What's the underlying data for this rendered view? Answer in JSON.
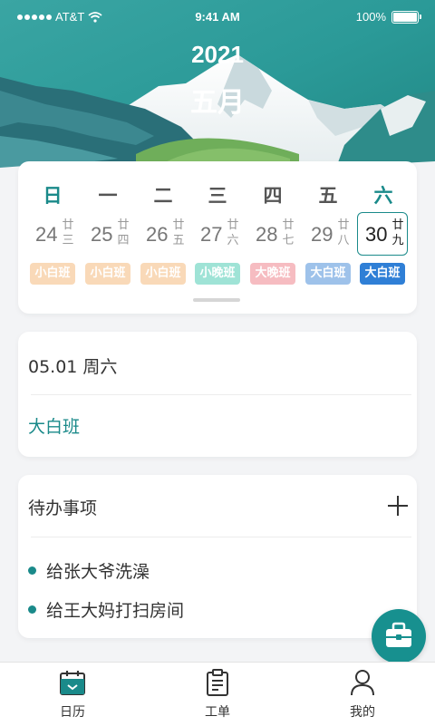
{
  "status_bar": {
    "carrier": "AT&T",
    "time": "9:41 AM",
    "battery": "100%"
  },
  "header": {
    "year": "2021",
    "month": "五月"
  },
  "calendar": {
    "weekdays": [
      "日",
      "一",
      "二",
      "三",
      "四",
      "五",
      "六"
    ],
    "days": [
      {
        "num": "24",
        "lunar": "廿三",
        "shift": "小白班",
        "shift_color": "#f9d9b8",
        "shift_text_color": "#ffffff"
      },
      {
        "num": "25",
        "lunar": "廿四",
        "shift": "小白班",
        "shift_color": "#f9d9b8",
        "shift_text_color": "#ffffff"
      },
      {
        "num": "26",
        "lunar": "廿五",
        "shift": "小白班",
        "shift_color": "#f9d9b8",
        "shift_text_color": "#ffffff"
      },
      {
        "num": "27",
        "lunar": "廿六",
        "shift": "小晚班",
        "shift_color": "#9fe3d6",
        "shift_text_color": "#ffffff"
      },
      {
        "num": "28",
        "lunar": "廿七",
        "shift": "大晚班",
        "shift_color": "#f6bcc1",
        "shift_text_color": "#ffffff"
      },
      {
        "num": "29",
        "lunar": "廿八",
        "shift": "大白班",
        "shift_color": "#9ec2ea",
        "shift_text_color": "#ffffff"
      },
      {
        "num": "30",
        "lunar": "廿九",
        "shift": "大白班",
        "shift_color": "#2f7fd6",
        "shift_text_color": "#ffffff"
      }
    ],
    "selected_index": 6
  },
  "selected_day": {
    "date": "05.01 周六",
    "shift": "大白班"
  },
  "todo": {
    "title": "待办事项",
    "items": [
      "给张大爷洗澡",
      "给王大妈打扫房间"
    ]
  },
  "tabs": [
    {
      "label": "日历",
      "icon": "calendar-icon"
    },
    {
      "label": "工单",
      "icon": "clipboard-icon"
    },
    {
      "label": "我的",
      "icon": "user-icon"
    }
  ],
  "colors": {
    "accent": "#1a8a8a",
    "fab": "#17908f"
  },
  "fab": {
    "icon": "briefcase-icon"
  }
}
